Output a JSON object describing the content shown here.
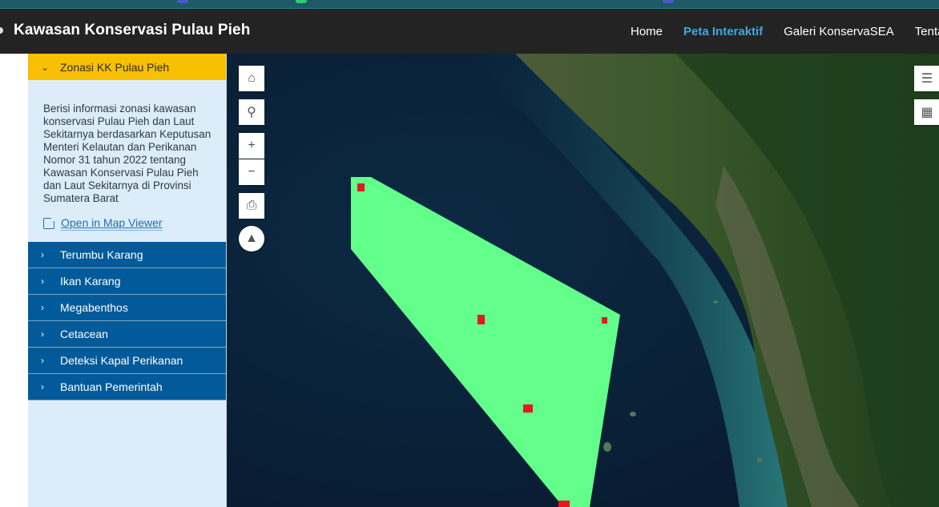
{
  "header": {
    "site_title": "Kawasan Konservasi Pulau Pieh",
    "nav": [
      "Home",
      "Peta Interaktif",
      "Galeri KonservaSEA",
      "Tenta"
    ],
    "active_nav": "Peta Interaktif"
  },
  "sidebar": {
    "active_section": {
      "label": "Zonasi KK Pulau Pieh",
      "description": "Berisi informasi zonasi kawasan konservasi Pulau Pieh dan Laut Sekitarnya berdasarkan Keputusan Menteri Kelautan dan Perikanan Nomor 31 tahun 2022 tentang Kawasan Konservasi Pulau Pieh dan Laut Sekitarnya di Provinsi Sumatera Barat",
      "link_label": "Open in Map Viewer"
    },
    "items": [
      {
        "label": "Terumbu Karang"
      },
      {
        "label": "Ikan Karang"
      },
      {
        "label": "Megabenthos"
      },
      {
        "label": "Cetacean"
      },
      {
        "label": "Deteksi Kapal Perikanan"
      },
      {
        "label": "Bantuan Pemerintah"
      }
    ]
  },
  "map": {
    "tools": [
      "home-icon",
      "search-icon",
      "zoom-in-icon",
      "zoom-out-icon",
      "print-icon",
      "compass-icon"
    ],
    "right_tools": [
      "layers-icon",
      "qr-icon"
    ],
    "zone_color": "#62ff8a",
    "marker_color": "#e8171f"
  },
  "colors": {
    "header_bg": "#232323",
    "active_nav": "#3fa9e0",
    "active_section_bg": "#f8c000",
    "item_bg": "#035a9a",
    "panel_bg": "#dcecf9"
  }
}
